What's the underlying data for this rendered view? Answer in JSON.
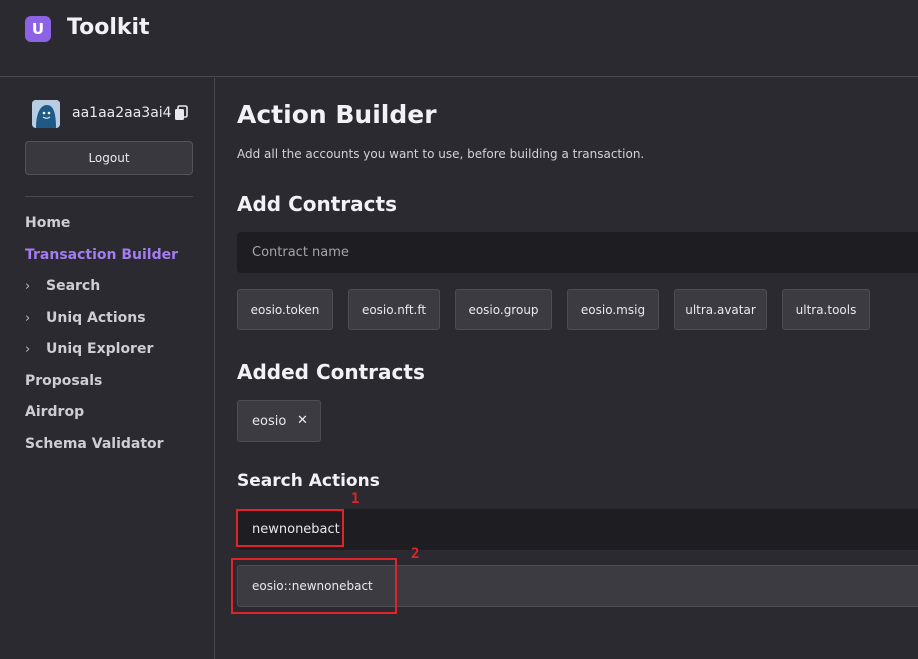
{
  "app": {
    "logo_letter": "U",
    "title": "Toolkit",
    "brand_color": "#8d63e6"
  },
  "sidebar": {
    "account": {
      "name": "aa1aa2aa3ai4",
      "avatar_icon": "avatar-icon",
      "copy_icon": "copy-icon"
    },
    "logout_label": "Logout",
    "items": [
      {
        "label": "Home",
        "expandable": false,
        "active": false
      },
      {
        "label": "Transaction Builder",
        "expandable": false,
        "active": true
      },
      {
        "label": "Search",
        "expandable": true,
        "active": false
      },
      {
        "label": "Uniq Actions",
        "expandable": true,
        "active": false
      },
      {
        "label": "Uniq Explorer",
        "expandable": true,
        "active": false
      },
      {
        "label": "Proposals",
        "expandable": false,
        "active": false
      },
      {
        "label": "Airdrop",
        "expandable": false,
        "active": false
      },
      {
        "label": "Schema Validator",
        "expandable": false,
        "active": false
      }
    ],
    "chevron_glyph": "›"
  },
  "main": {
    "title": "Action Builder",
    "subtitle": "Add all the accounts you want to use, before building a transaction.",
    "add_contracts": {
      "title": "Add Contracts",
      "placeholder": "Contract name",
      "suggestions": [
        "eosio.token",
        "eosio.nft.ft",
        "eosio.group",
        "eosio.msig",
        "ultra.avatar",
        "ultra.tools"
      ]
    },
    "added_contracts": {
      "title": "Added Contracts",
      "items": [
        {
          "label": "eosio",
          "remove_glyph": "✕"
        }
      ]
    },
    "search_actions": {
      "title": "Search Actions",
      "value": "newnonebact",
      "results": [
        "eosio::newnonebact"
      ]
    }
  },
  "annotations": [
    {
      "label": "1"
    },
    {
      "label": "2"
    }
  ]
}
